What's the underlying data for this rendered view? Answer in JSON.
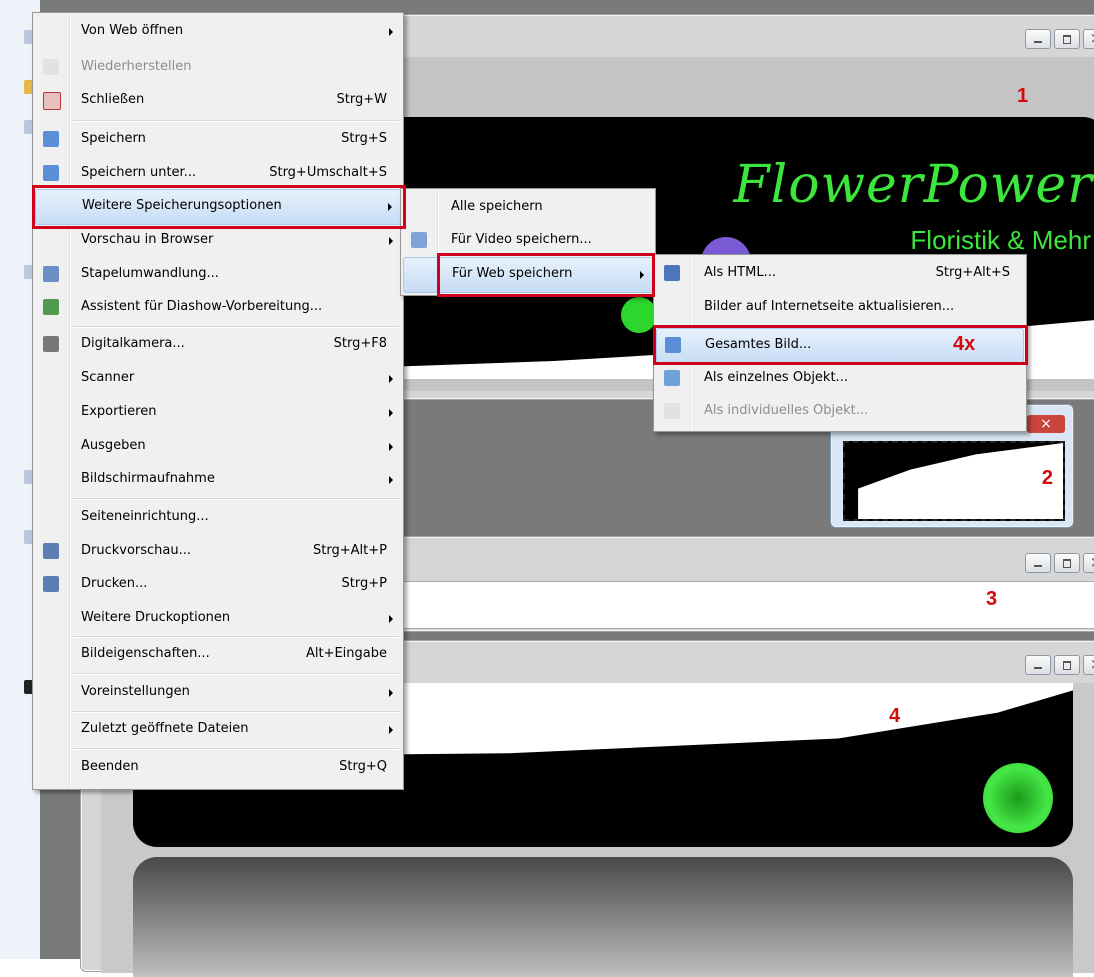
{
  "main_menu": {
    "items": [
      {
        "label": "Von Web öffnen",
        "shortcut": "",
        "submenu": true,
        "disabled": false
      },
      {
        "label": "Wiederherstellen",
        "shortcut": "",
        "submenu": false,
        "disabled": true
      },
      {
        "label": "Schließen",
        "shortcut": "Strg+W",
        "submenu": false,
        "disabled": false
      },
      {
        "label": "Speichern",
        "shortcut": "Strg+S",
        "submenu": false,
        "disabled": false
      },
      {
        "label": "Speichern unter...",
        "shortcut": "Strg+Umschalt+S",
        "submenu": false,
        "disabled": false
      },
      {
        "label": "Weitere Speicherungsoptionen",
        "shortcut": "",
        "submenu": true,
        "disabled": false
      },
      {
        "label": "Vorschau in Browser",
        "shortcut": "",
        "submenu": true,
        "disabled": false
      },
      {
        "label": "Stapelumwandlung...",
        "shortcut": "",
        "submenu": false,
        "disabled": false
      },
      {
        "label": "Assistent für Diashow-Vorbereitung...",
        "shortcut": "",
        "submenu": false,
        "disabled": false
      },
      {
        "label": "Digitalkamera...",
        "shortcut": "Strg+F8",
        "submenu": false,
        "disabled": false
      },
      {
        "label": "Scanner",
        "shortcut": "",
        "submenu": true,
        "disabled": false
      },
      {
        "label": "Exportieren",
        "shortcut": "",
        "submenu": true,
        "disabled": false
      },
      {
        "label": "Ausgeben",
        "shortcut": "",
        "submenu": true,
        "disabled": false
      },
      {
        "label": "Bildschirmaufnahme",
        "shortcut": "",
        "submenu": true,
        "disabled": false
      },
      {
        "label": "Seiteneinrichtung...",
        "shortcut": "",
        "submenu": false,
        "disabled": false
      },
      {
        "label": "Druckvorschau...",
        "shortcut": "Strg+Alt+P",
        "submenu": false,
        "disabled": false
      },
      {
        "label": "Drucken...",
        "shortcut": "Strg+P",
        "submenu": false,
        "disabled": false
      },
      {
        "label": "Weitere Druckoptionen",
        "shortcut": "",
        "submenu": true,
        "disabled": false
      },
      {
        "label": "Bildeigenschaften...",
        "shortcut": "Alt+Eingabe",
        "submenu": false,
        "disabled": false
      },
      {
        "label": "Voreinstellungen",
        "shortcut": "",
        "submenu": true,
        "disabled": false
      },
      {
        "label": "Zuletzt geöffnete Dateien",
        "shortcut": "",
        "submenu": true,
        "disabled": false
      },
      {
        "label": "Beenden",
        "shortcut": "Strg+Q",
        "submenu": false,
        "disabled": false
      }
    ]
  },
  "save_options_menu": {
    "items": [
      {
        "label": "Alle speichern",
        "submenu": false
      },
      {
        "label": "Für Video speichern...",
        "submenu": false
      },
      {
        "label": "Für Web speichern",
        "submenu": true
      }
    ]
  },
  "web_save_menu": {
    "items": [
      {
        "label": "Als HTML...",
        "shortcut": "Strg+Alt+S",
        "disabled": false
      },
      {
        "label": "Bilder auf Internetseite aktualisieren...",
        "shortcut": "",
        "disabled": false
      },
      {
        "label": "Gesamtes Bild...",
        "shortcut": "",
        "disabled": false
      },
      {
        "label": "Als einzelnes Objekt...",
        "shortcut": "",
        "disabled": false
      },
      {
        "label": "Als individuelles Objekt...",
        "shortcut": "",
        "disabled": true
      }
    ]
  },
  "annotations": {
    "gesamtes_bild_note": "4x"
  },
  "windows": {
    "win1": {
      "badge": "1"
    },
    "win2": {
      "badge": "2"
    },
    "win3": {
      "badge": "3"
    },
    "win4": {
      "badge": "4"
    }
  },
  "banner": {
    "title": "FlowerPower",
    "subtitle": "Floristik & Mehr"
  },
  "colors": {
    "brand_green": "#3de63d",
    "annotation_red": "#d0021b",
    "menu_bg": "#f0f0f0",
    "highlight": "#c6dcf5"
  }
}
